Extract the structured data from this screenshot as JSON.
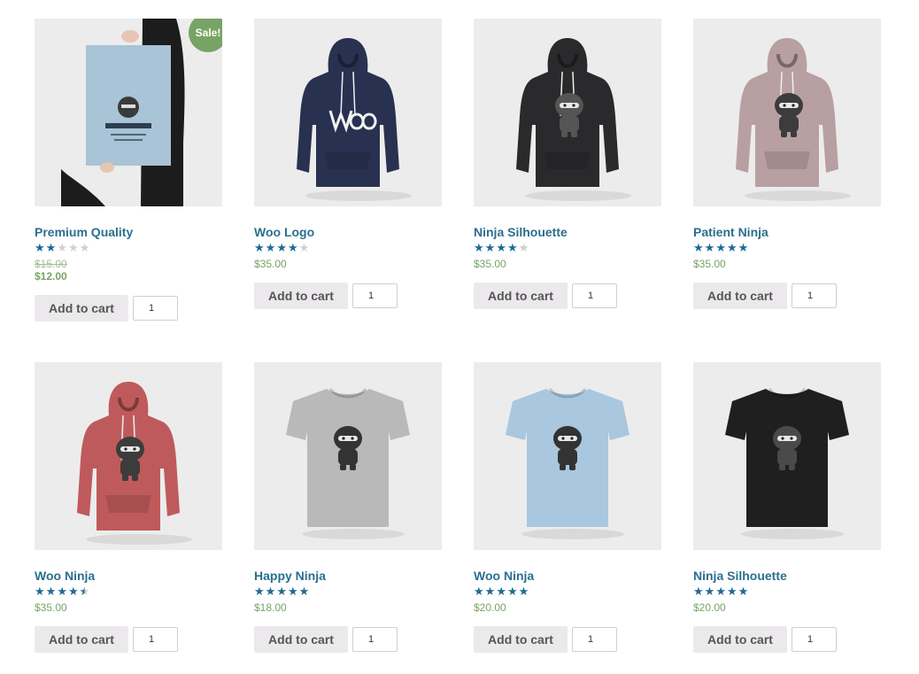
{
  "products": [
    {
      "title": "Premium Quality",
      "rating": 2,
      "old_price": "$15.00",
      "price": "$12.00",
      "sale_badge": "Sale!",
      "image": "poster",
      "add_label": "Add to cart",
      "qty": "1"
    },
    {
      "title": "Woo Logo",
      "rating": 4,
      "price": "$35.00",
      "image": "hoodie-navy-woo",
      "add_label": "Add to cart",
      "qty": "1"
    },
    {
      "title": "Ninja Silhouette",
      "rating": 4,
      "price": "$35.00",
      "image": "hoodie-black",
      "add_label": "Add to cart",
      "qty": "1"
    },
    {
      "title": "Patient Ninja",
      "rating": 5,
      "price": "$35.00",
      "image": "hoodie-mauve",
      "add_label": "Add to cart",
      "qty": "1"
    },
    {
      "title": "Woo Ninja",
      "rating": 4.5,
      "price": "$35.00",
      "image": "hoodie-red",
      "add_label": "Add to cart",
      "qty": "1"
    },
    {
      "title": "Happy Ninja",
      "rating": 5,
      "price": "$18.00",
      "image": "tshirt-grey",
      "add_label": "Add to cart",
      "qty": "1"
    },
    {
      "title": "Woo Ninja",
      "rating": 5,
      "price": "$20.00",
      "image": "tshirt-lightblue",
      "add_label": "Add to cart",
      "qty": "1"
    },
    {
      "title": "Ninja Silhouette",
      "rating": 5,
      "price": "$20.00",
      "image": "tshirt-black",
      "add_label": "Add to cart",
      "qty": "1"
    }
  ],
  "colors": {
    "title": "#2a6f8e",
    "star": "#1e6a95",
    "price": "#77a464",
    "sale_badge": "#77a464",
    "button_bg": "#ebe9eb",
    "hoodie_navy": "#283150",
    "hoodie_black": "#2a2a2c",
    "hoodie_mauve": "#b89fa2",
    "hoodie_red": "#bf5a5c",
    "tshirt_grey": "#b9b9b9",
    "tshirt_lightblue": "#a9c7de",
    "tshirt_black": "#1f1f1f"
  }
}
